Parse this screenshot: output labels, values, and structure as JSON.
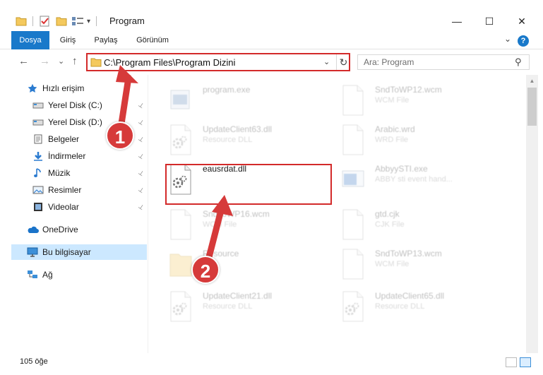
{
  "window": {
    "title": "Program",
    "minimize_glyph": "—",
    "maximize_glyph": "☐",
    "close_glyph": "✕"
  },
  "ribbon": {
    "tabs": [
      "Dosya",
      "Giriş",
      "Paylaş",
      "Görünüm"
    ],
    "help_glyph": "?",
    "expand_glyph": "⌄"
  },
  "nav": {
    "back_glyph": "←",
    "forward_glyph": "→",
    "history_glyph": "⌄",
    "up_glyph": "↑",
    "address": "C:\\Program Files\\Program Dizini",
    "address_chevron": "⌄",
    "refresh_glyph": "↻",
    "search_placeholder": "Ara: Program",
    "search_glyph": "⚲"
  },
  "sidebar": {
    "items": [
      {
        "label": "Hızlı erişim",
        "icon": "star-icon",
        "pinned": false,
        "indent": 1
      },
      {
        "label": "Yerel Disk (C:)",
        "icon": "drive-icon",
        "pinned": true,
        "indent": 2
      },
      {
        "label": "Yerel Disk (D:)",
        "icon": "drive-icon",
        "pinned": true,
        "indent": 2
      },
      {
        "label": "Belgeler",
        "icon": "documents-icon",
        "pinned": true,
        "indent": 2
      },
      {
        "label": "İndirmeler",
        "icon": "download-icon",
        "pinned": true,
        "indent": 2
      },
      {
        "label": "Müzik",
        "icon": "music-icon",
        "pinned": true,
        "indent": 2
      },
      {
        "label": "Resimler",
        "icon": "pictures-icon",
        "pinned": true,
        "indent": 2
      },
      {
        "label": "Videolar",
        "icon": "video-icon",
        "pinned": true,
        "indent": 2
      },
      {
        "label": "OneDrive",
        "icon": "cloud-icon",
        "pinned": false,
        "indent": 1
      },
      {
        "label": "Bu bilgisayar",
        "icon": "computer-icon",
        "pinned": false,
        "indent": 1,
        "selected": true
      },
      {
        "label": "Ağ",
        "icon": "network-icon",
        "pinned": false,
        "indent": 1
      }
    ],
    "pin_glyph": "📌"
  },
  "files": [
    {
      "name": "program.exe",
      "type": "",
      "icon": "exe-icon",
      "faded": true
    },
    {
      "name": "SndToWP12.wcm",
      "type": "WCM File",
      "icon": "blank-file-icon",
      "faded": true
    },
    {
      "name": "UpdateClient63.dll",
      "type": "Resource DLL",
      "icon": "dll-icon",
      "faded": true
    },
    {
      "name": "Arabic.wrd",
      "type": "WRD File",
      "icon": "blank-file-icon",
      "faded": true
    },
    {
      "name": "eausrdat.dll",
      "type": "",
      "icon": "dll-icon",
      "faded": false
    },
    {
      "name": "AbbyySTI.exe",
      "type": "ABBY sti event hand...",
      "icon": "app-icon",
      "faded": true
    },
    {
      "name": "SndToWP16.wcm",
      "type": "WCM File",
      "icon": "blank-file-icon",
      "faded": true
    },
    {
      "name": "gtd.cjk",
      "type": "CJK File",
      "icon": "blank-file-icon",
      "faded": true
    },
    {
      "name": "Resource",
      "type": "",
      "icon": "folder-icon",
      "faded": true
    },
    {
      "name": "SndToWP13.wcm",
      "type": "WCM File",
      "icon": "blank-file-icon",
      "faded": true
    },
    {
      "name": "UpdateClient21.dll",
      "type": "Resource DLL",
      "icon": "dll-icon",
      "faded": true
    },
    {
      "name": "UpdateClient65.dll",
      "type": "Resource DLL",
      "icon": "dll-icon",
      "faded": true
    }
  ],
  "status": {
    "item_count": "105 öğe"
  },
  "markers": [
    "1",
    "2"
  ],
  "colors": {
    "accent": "#1979ca",
    "highlight_red": "#d32a2a",
    "marker_red": "#d63a3a",
    "selected_bg": "#cce8ff"
  }
}
